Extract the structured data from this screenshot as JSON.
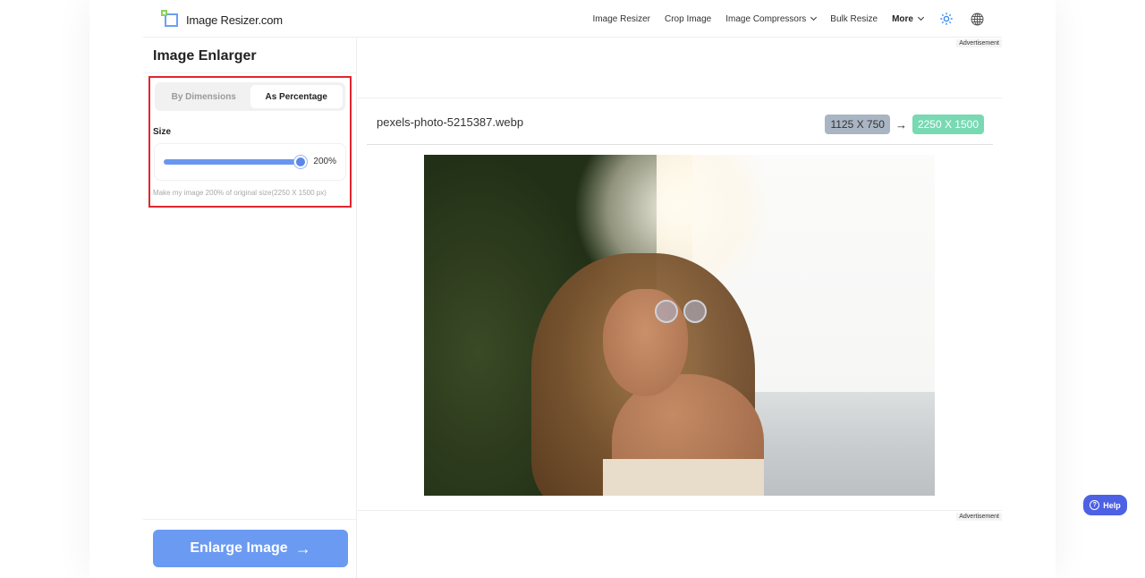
{
  "header": {
    "logo_text": "Image Resizer.com",
    "nav": [
      {
        "label": "Image Resizer",
        "dropdown": false
      },
      {
        "label": "Crop Image",
        "dropdown": false
      },
      {
        "label": "Image Compressors",
        "dropdown": true
      },
      {
        "label": "Bulk Resize",
        "dropdown": false
      },
      {
        "label": "More",
        "dropdown": true
      }
    ],
    "icons": [
      "sun-icon",
      "globe-icon"
    ]
  },
  "left_panel": {
    "title": "Image Enlarger",
    "tabs": [
      {
        "label": "By Dimensions",
        "active": false
      },
      {
        "label": "As Percentage",
        "active": true
      }
    ],
    "size_label": "Size",
    "slider": {
      "value_label": "200%",
      "value_percent": 200,
      "fill_fraction": 1.0
    },
    "hint": "Make my image 200% of original size(2250 X 1500 px)",
    "enlarge_button": "Enlarge Image",
    "enlarge_arrow": "→"
  },
  "right_panel": {
    "ad_label_top": "Advertisement",
    "ad_label_bottom": "Advertisement",
    "file_name": "pexels-photo-5215387.webp",
    "original_dims": "1125 X 750",
    "arrow": "→",
    "new_dims": "2250 X 1500",
    "image_alt": "Woman with curly hair and round sunglasses by the sea"
  },
  "help": {
    "label": "Help",
    "icon_glyph": "?"
  },
  "colors": {
    "accent_blue": "#6b9af3",
    "highlight_red": "#e1262d",
    "old_dims_badge": "#a9b5c2",
    "new_dims_badge": "#78d9b3",
    "help_button": "#4d61e4"
  }
}
